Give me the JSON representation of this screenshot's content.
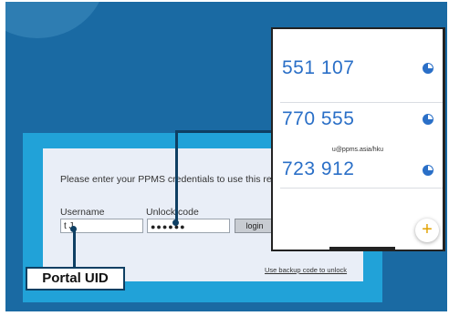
{
  "login": {
    "prompt": "Please enter your PPMS credentials to use this resou",
    "username_label": "Username",
    "unlock_label": "Unlock code",
    "username_value": "t                 J",
    "unlock_value": "●●●●●●",
    "login_button": "login",
    "backup_link": "Use backup code to unlock"
  },
  "callout": {
    "label": "Portal UID"
  },
  "authenticator": {
    "codes": [
      "551 107",
      "770 555",
      "723 912"
    ],
    "account": "u@ppms.asia/hku",
    "add_button": "+"
  },
  "colors": {
    "background": "#1a6aa3",
    "frame": "#21a2d8",
    "code": "#2a6fc7",
    "connector": "#0e3f63"
  }
}
